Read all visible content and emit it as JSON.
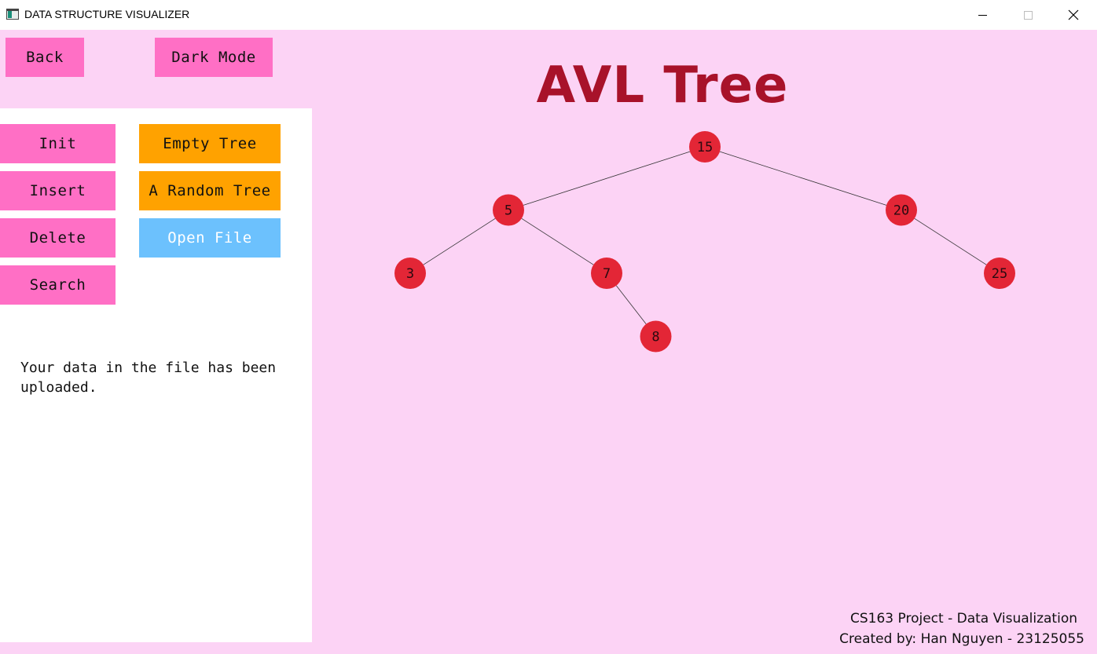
{
  "window": {
    "title": "DATA STRUCTURE VISUALIZER"
  },
  "top_buttons": {
    "back": "Back",
    "dark_mode": "Dark Mode"
  },
  "operations": {
    "init": "Init",
    "insert": "Insert",
    "delete": "Delete",
    "search": "Search"
  },
  "generators": {
    "empty_tree": "Empty Tree",
    "random_tree": "A Random Tree",
    "open_file": "Open File"
  },
  "status_message": "Your data in the file has been uploaded.",
  "heading": "AVL Tree",
  "tree": {
    "root": "15",
    "nodes": [
      {
        "value": "15",
        "left": "5",
        "right": "20"
      },
      {
        "value": "5",
        "left": "3",
        "right": "7"
      },
      {
        "value": "20",
        "left": null,
        "right": "25"
      },
      {
        "value": "3",
        "left": null,
        "right": null
      },
      {
        "value": "7",
        "left": null,
        "right": "8"
      },
      {
        "value": "25",
        "left": null,
        "right": null
      },
      {
        "value": "8",
        "left": null,
        "right": null
      }
    ]
  },
  "footer": {
    "line1": "CS163 Project - Data Visualization",
    "line2": "Created by: Han Nguyen - 23125055"
  },
  "colors": {
    "background": "#fcd3f5",
    "panel": "#ffffff",
    "pink_button": "#ff6fc5",
    "orange_button": "#ffa200",
    "blue_button": "#6cc1fd",
    "heading": "#a8122a",
    "node": "#e32636"
  }
}
